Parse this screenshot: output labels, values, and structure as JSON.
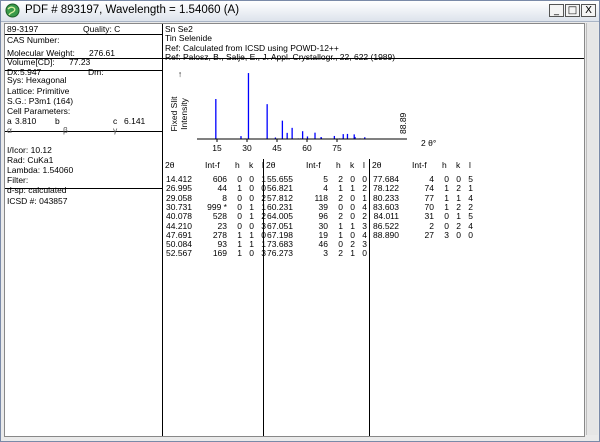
{
  "window": {
    "title": "PDF # 893197,  Wavelength = 1.54060   (A)",
    "controls": [
      "_",
      "□",
      "X"
    ]
  },
  "card": {
    "pdf_number": "89-3197",
    "quality": "Quality: C",
    "cas": "CAS Number:",
    "mw_label": "Molecular Weight:",
    "mw_value": "276.61",
    "vol_label": "Volume[CD]:",
    "vol_value": "77.23",
    "dx_label": "Dx:",
    "dx_value": "5.947",
    "dm_label": "Dm:",
    "sys": "Sys: Hexagonal",
    "lattice": "Lattice: Primitive",
    "sg": "S.G.: P3m1 (164)",
    "cell": "Cell Parameters:",
    "a_label": "a",
    "a_value": "3.810",
    "b_label": "b",
    "c_label": "c",
    "c_value": "6.141",
    "alpha": "α",
    "beta": "β",
    "gamma": "γ",
    "icor": "I/Icor:  10.12",
    "rad": "Rad: CuKa1",
    "lambda": "Lambda: 1.54060",
    "filter": "Filter:",
    "dsp": "d-sp: calculated",
    "icsd": "ICSD #:  043857",
    "formula": "Sn Se2",
    "name": "Tin Selenide",
    "ref1": "Ref:  Calculated from ICSD using POWD-12++",
    "ref2": "Ref:  Palosz, B., Salje, E., J. Appl. Crystallogr., 22, 622 (1989)"
  },
  "pattern": {
    "y_label1": "Fixed  Slit",
    "y_label2": "Intensity",
    "x_label": "2 θ°",
    "x_ticks": [
      "15",
      "30",
      "45",
      "60",
      "75"
    ],
    "peak_label": "88.89"
  },
  "chart_data": {
    "type": "bar",
    "xlabel": "2 θ°",
    "ylabel": "Fixed Slit Intensity",
    "xlim": [
      5,
      95
    ],
    "ylim": [
      0,
      1000
    ],
    "x": [
      14.412,
      26.995,
      29.058,
      30.731,
      40.078,
      44.21,
      47.691,
      50.084,
      52.567,
      55.655,
      56.821,
      57.812,
      60.231,
      64.005,
      67.051,
      67.198,
      73.683,
      76.273,
      77.684,
      78.122,
      80.233,
      83.603,
      84.011,
      86.522,
      88.89
    ],
    "values": [
      606,
      44,
      8,
      999,
      528,
      23,
      278,
      93,
      169,
      5,
      4,
      118,
      39,
      96,
      30,
      19,
      46,
      3,
      4,
      74,
      77,
      70,
      31,
      2,
      27
    ]
  },
  "table": {
    "headers": [
      "2θ",
      "Int-f",
      "h",
      "k",
      "l"
    ],
    "columns": [
      [
        [
          "14.412",
          "606",
          "0",
          "0",
          "1"
        ],
        [
          "26.995",
          "44",
          "1",
          "0",
          "0"
        ],
        [
          "29.058",
          "8",
          "0",
          "0",
          "2"
        ],
        [
          "30.731",
          "999 *",
          "0",
          "1",
          "1"
        ],
        [
          "40.078",
          "528",
          "0",
          "1",
          "2"
        ],
        [
          "44.210",
          "23",
          "0",
          "0",
          "3"
        ],
        [
          "47.691",
          "278",
          "1",
          "1",
          "0"
        ],
        [
          "50.084",
          "93",
          "1",
          "1",
          "1"
        ],
        [
          "52.567",
          "169",
          "1",
          "0",
          "3"
        ]
      ],
      [
        [
          "55.655",
          "5",
          "2",
          "0",
          "0"
        ],
        [
          "56.821",
          "4",
          "1",
          "1",
          "2"
        ],
        [
          "57.812",
          "118",
          "2",
          "0",
          "1"
        ],
        [
          "60.231",
          "39",
          "0",
          "0",
          "4"
        ],
        [
          "64.005",
          "96",
          "2",
          "0",
          "2"
        ],
        [
          "67.051",
          "30",
          "1",
          "1",
          "3"
        ],
        [
          "67.198",
          "19",
          "1",
          "0",
          "4"
        ],
        [
          "73.683",
          "46",
          "0",
          "2",
          "3"
        ],
        [
          "76.273",
          "3",
          "2",
          "1",
          "0"
        ]
      ],
      [
        [
          "77.684",
          "4",
          "0",
          "0",
          "5"
        ],
        [
          "78.122",
          "74",
          "1",
          "2",
          "1"
        ],
        [
          "80.233",
          "77",
          "1",
          "1",
          "4"
        ],
        [
          "83.603",
          "70",
          "1",
          "2",
          "2"
        ],
        [
          "84.011",
          "31",
          "0",
          "1",
          "5"
        ],
        [
          "86.522",
          "2",
          "0",
          "2",
          "4"
        ],
        [
          "88.890",
          "27",
          "3",
          "0",
          "0"
        ]
      ]
    ]
  }
}
